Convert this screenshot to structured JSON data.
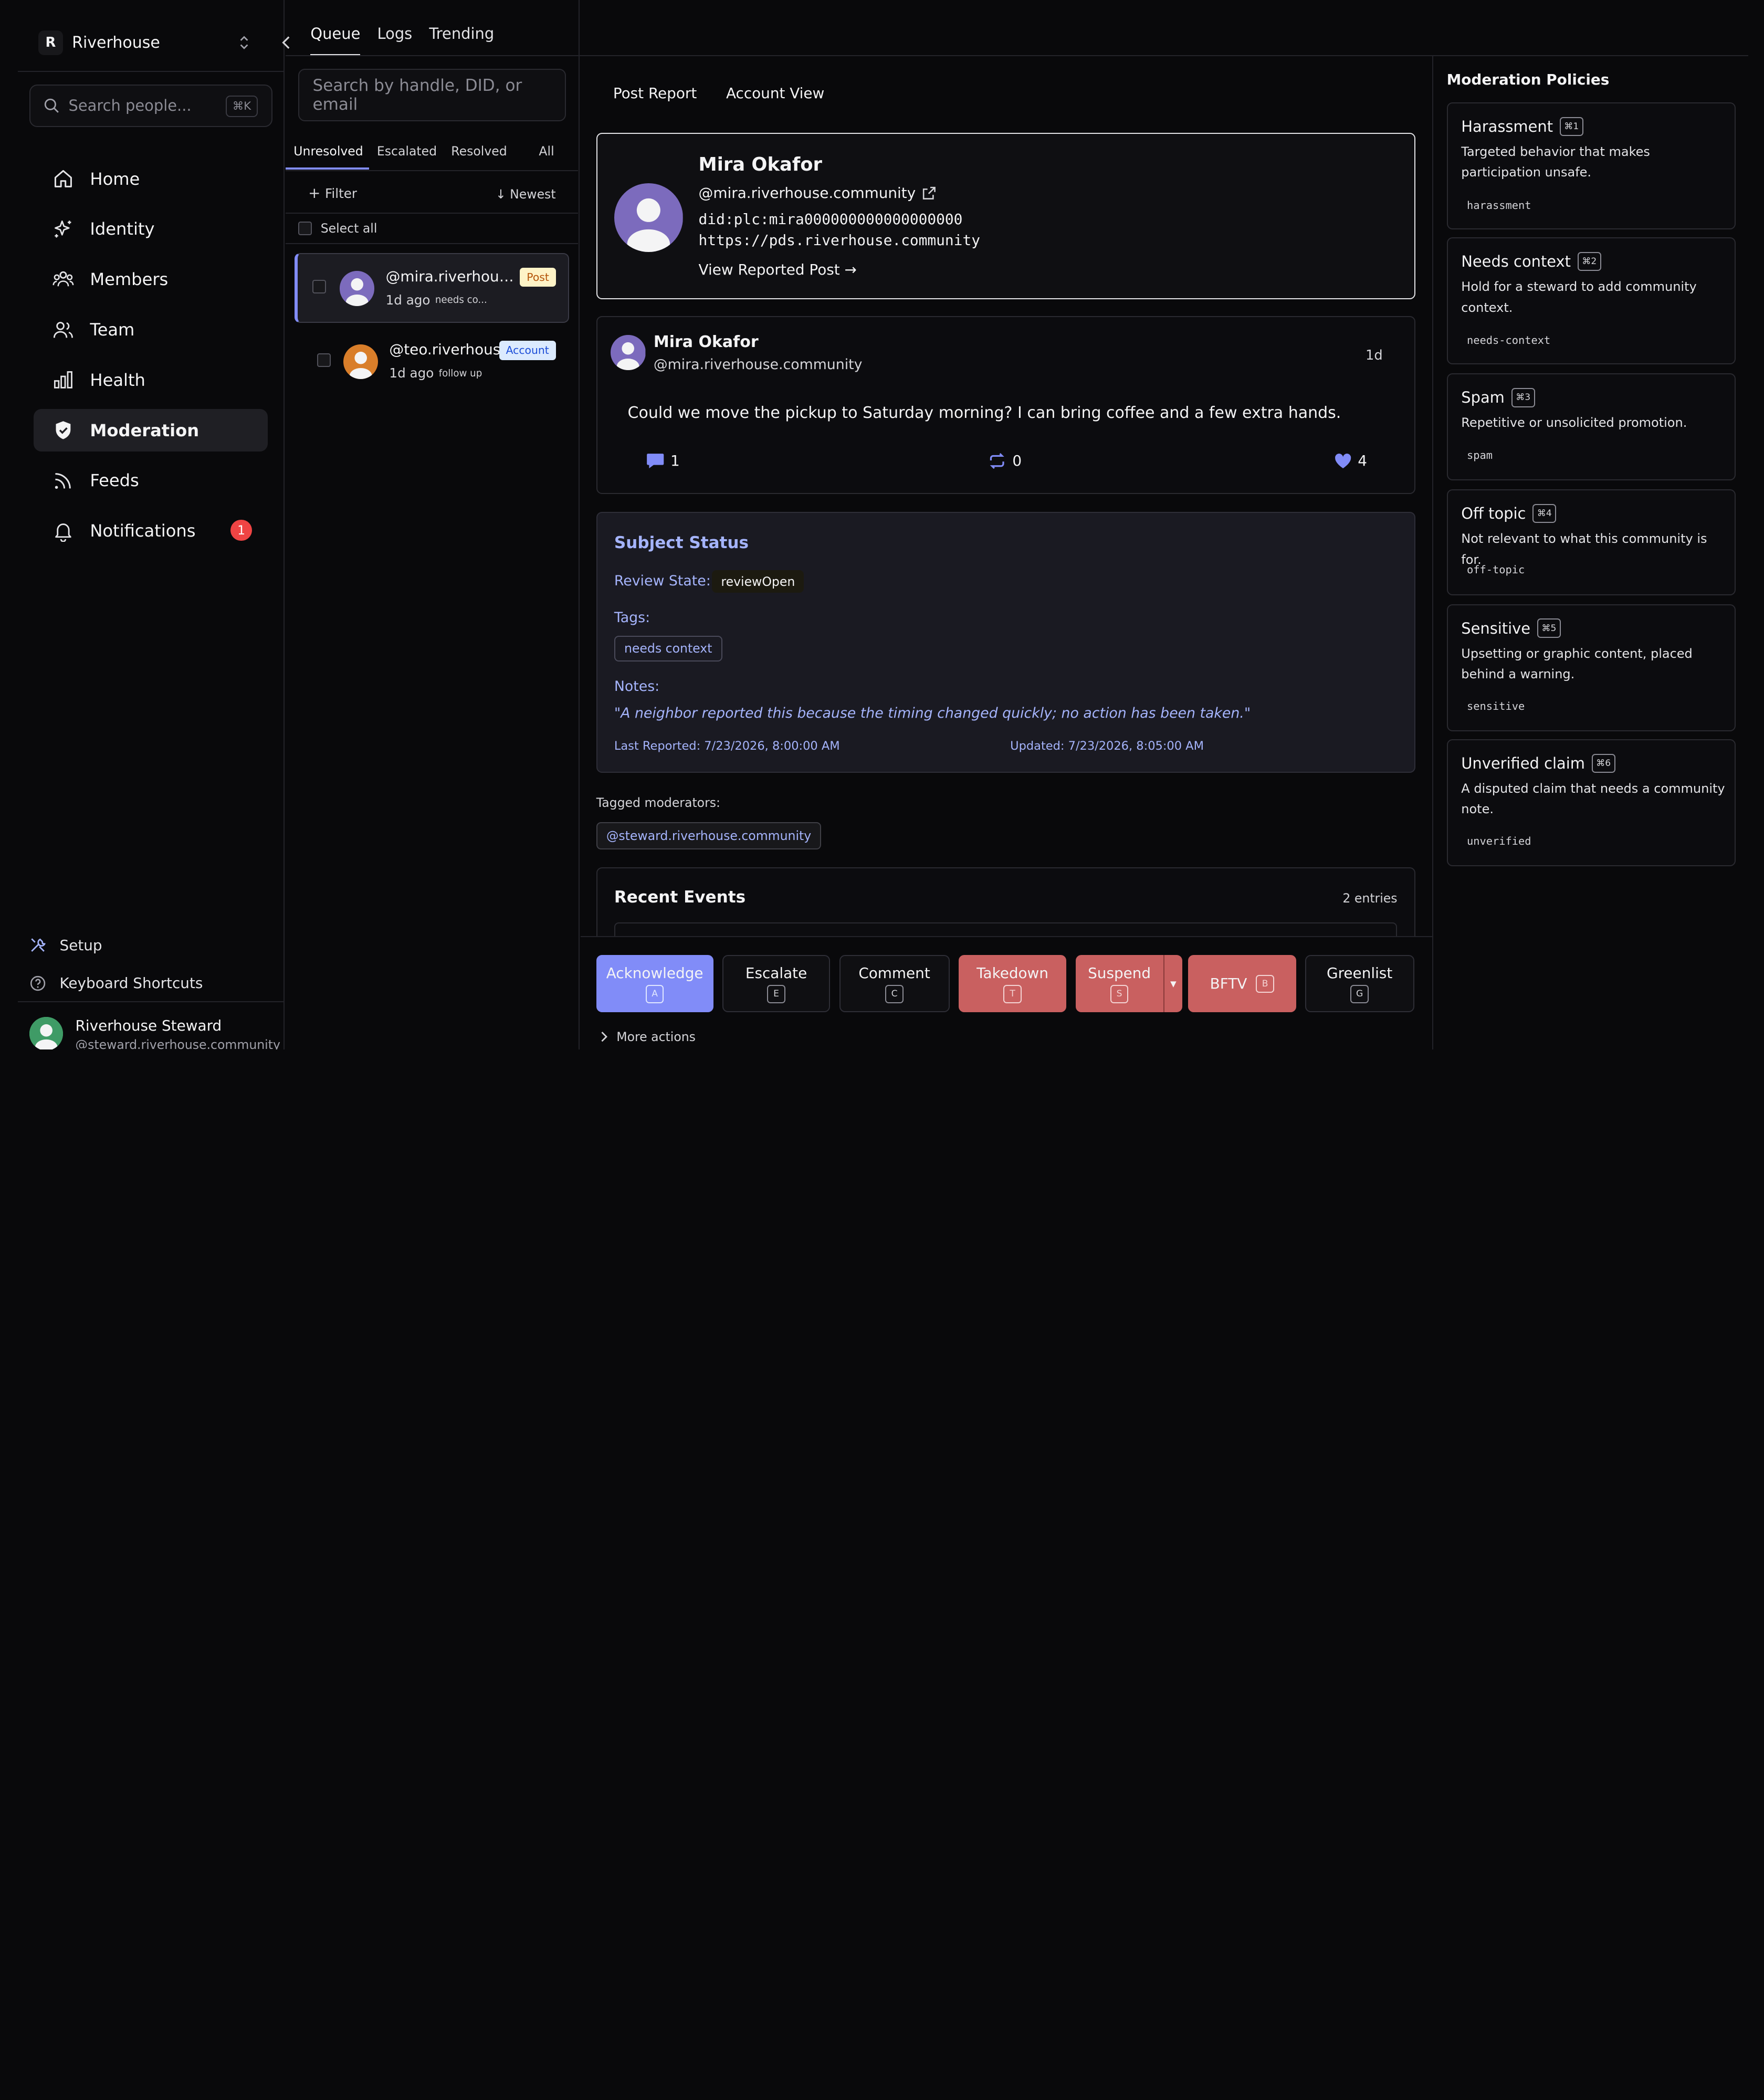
{
  "workspace": {
    "badge": "R",
    "name": "Riverhouse"
  },
  "sidebar": {
    "search_placeholder": "Search people...",
    "search_kbd": "⌘K",
    "nav": [
      {
        "label": "Home",
        "icon": "home-icon"
      },
      {
        "label": "Identity",
        "icon": "sparkles-icon"
      },
      {
        "label": "Members",
        "icon": "users-group-icon"
      },
      {
        "label": "Team",
        "icon": "team-icon"
      },
      {
        "label": "Health",
        "icon": "bar-chart-icon"
      },
      {
        "label": "Moderation",
        "icon": "shield-check-icon",
        "active": true
      },
      {
        "label": "Feeds",
        "icon": "rss-icon"
      },
      {
        "label": "Notifications",
        "icon": "bell-icon",
        "badge": "1"
      }
    ],
    "setup": "Setup",
    "shortcuts": "Keyboard Shortcuts",
    "user": {
      "name": "Riverhouse Steward",
      "handle": "@steward.riverhouse.community"
    }
  },
  "top_tabs": [
    "Queue",
    "Logs",
    "Trending"
  ],
  "queue": {
    "search_placeholder": "Search by handle, DID, or email",
    "status_tabs": [
      "Unresolved",
      "Escalated",
      "Resolved",
      "All"
    ],
    "filter": "Filter",
    "sort": "↓ Newest",
    "select_all": "Select all",
    "items": [
      {
        "handle": "@mira.riverhouse.community",
        "time": "1d ago",
        "tag": "needs co...",
        "type": "Post"
      },
      {
        "handle": "@teo.riverhouse.community",
        "time": "1d ago",
        "tag": "follow up",
        "type": "Account"
      }
    ]
  },
  "main": {
    "tabs": [
      "Post Report",
      "Account View"
    ],
    "profile": {
      "name": "Mira Okafor",
      "handle": "@mira.riverhouse.community",
      "did": "did:plc:mira000000000000000000",
      "pds": "https://pds.riverhouse.community",
      "view_post": "View Reported Post →"
    },
    "post": {
      "author": "Mira Okafor",
      "handle": "@mira.riverhouse.community",
      "time": "1d",
      "text": "Could we move the pickup to Saturday morning? I can bring coffee and a few extra hands.",
      "replies": "1",
      "reposts": "0",
      "likes": "4"
    },
    "subject": {
      "title": "Subject Status",
      "review_label": "Review State:",
      "review_state": "reviewOpen",
      "tags_label": "Tags:",
      "tag": "needs context",
      "notes_label": "Notes:",
      "notes": "\"A neighbor reported this because the timing changed quickly; no action has been taken.\"",
      "last_reported": "Last Reported: 7/23/2026, 8:00:00 AM",
      "updated": "Updated: 7/23/2026, 8:05:00 AM"
    },
    "tagged_label": "Tagged moderators:",
    "tagged": "@steward.riverhouse.community",
    "events": {
      "title": "Recent Events",
      "count": "2 entries"
    }
  },
  "actions": [
    {
      "label": "Acknowledge",
      "key": "A",
      "style": "primary"
    },
    {
      "label": "Escalate",
      "key": "E",
      "style": "default"
    },
    {
      "label": "Comment",
      "key": "C",
      "style": "default"
    },
    {
      "label": "Takedown",
      "key": "T",
      "style": "danger"
    },
    {
      "label": "Suspend",
      "key": "S",
      "style": "danger"
    },
    {
      "label": "BFTV",
      "key": "B",
      "style": "danger"
    },
    {
      "label": "Greenlist",
      "key": "G",
      "style": "default"
    }
  ],
  "more_actions": "More actions",
  "policies": {
    "title": "Moderation Policies",
    "items": [
      {
        "name": "Harassment",
        "key": "⌘1",
        "desc": "Targeted behavior that makes participation unsafe.",
        "code": "harassment"
      },
      {
        "name": "Needs context",
        "key": "⌘2",
        "desc": "Hold for a steward to add community context.",
        "code": "needs-context"
      },
      {
        "name": "Spam",
        "key": "⌘3",
        "desc": "Repetitive or unsolicited promotion.",
        "code": "spam"
      },
      {
        "name": "Off topic",
        "key": "⌘4",
        "desc": "Not relevant to what this community is for.",
        "code": "off-topic"
      },
      {
        "name": "Sensitive",
        "key": "⌘5",
        "desc": "Upsetting or graphic content, placed behind a warning.",
        "code": "sensitive"
      },
      {
        "name": "Unverified claim",
        "key": "⌘6",
        "desc": "A disputed claim that needs a community note.",
        "code": "unverified"
      }
    ]
  },
  "colors": {
    "accent": "#818cf8",
    "danger": "#c96060",
    "badge": "#ef4444",
    "background": "#09090b"
  }
}
